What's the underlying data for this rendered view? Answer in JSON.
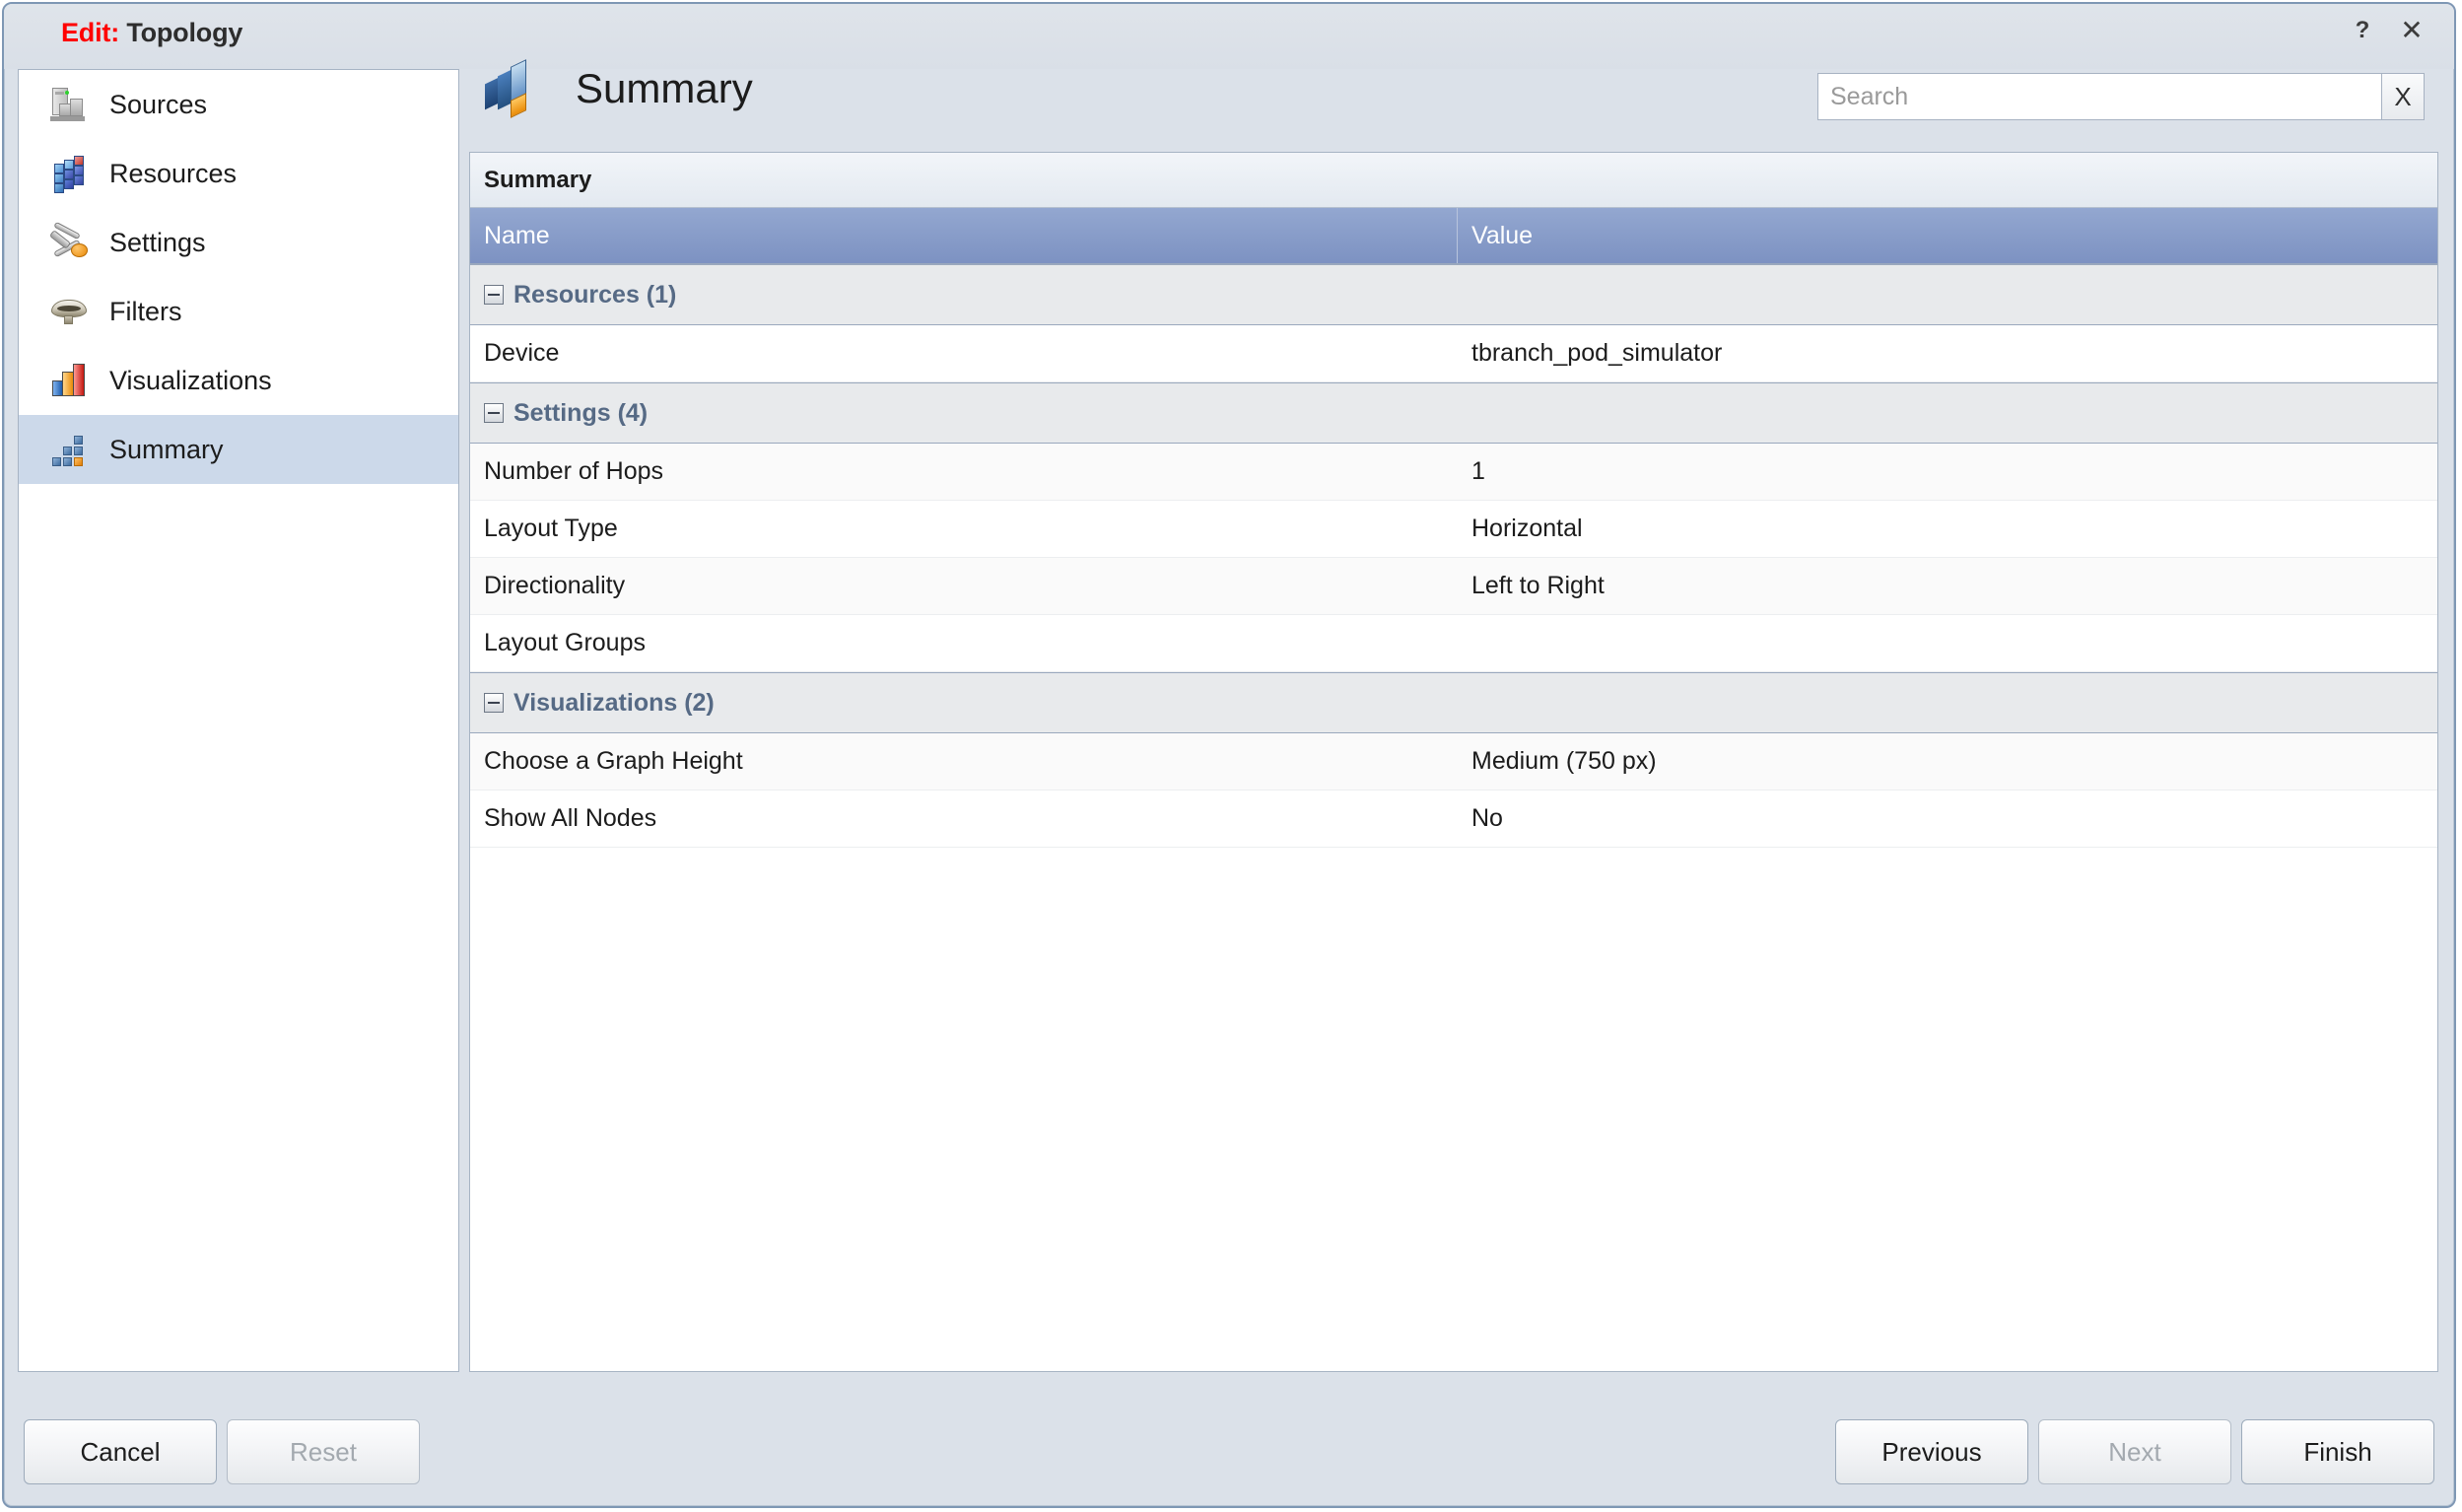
{
  "window": {
    "title_prefix": "Edit:",
    "title_main": "Topology",
    "help_glyph": "?",
    "close_glyph": "✕"
  },
  "sidebar": {
    "items": [
      {
        "label": "Sources",
        "icon": "server-rack-icon",
        "selected": false
      },
      {
        "label": "Resources",
        "icon": "cube-icon",
        "selected": false
      },
      {
        "label": "Settings",
        "icon": "tools-icon",
        "selected": false
      },
      {
        "label": "Filters",
        "icon": "funnel-icon",
        "selected": false
      },
      {
        "label": "Visualizations",
        "icon": "bar-chart-icon",
        "selected": false
      },
      {
        "label": "Summary",
        "icon": "blocks-icon",
        "selected": true
      }
    ]
  },
  "header": {
    "icon": "summary-blocks-icon",
    "title": "Summary"
  },
  "search": {
    "value": "",
    "placeholder": "Search",
    "clear_label": "X"
  },
  "panel": {
    "title": "Summary",
    "columns": {
      "name": "Name",
      "value": "Value"
    },
    "groups": [
      {
        "label": "Resources (1)",
        "expanded": true,
        "rows": [
          {
            "name": "Device",
            "value": "tbranch_pod_simulator"
          }
        ]
      },
      {
        "label": "Settings (4)",
        "expanded": true,
        "rows": [
          {
            "name": "Number of Hops",
            "value": "1"
          },
          {
            "name": "Layout Type",
            "value": "Horizontal"
          },
          {
            "name": "Directionality",
            "value": "Left to Right"
          },
          {
            "name": "Layout Groups",
            "value": ""
          }
        ]
      },
      {
        "label": "Visualizations (2)",
        "expanded": true,
        "rows": [
          {
            "name": "Choose a Graph Height",
            "value": "Medium (750 px)"
          },
          {
            "name": "Show All Nodes",
            "value": "No"
          }
        ]
      }
    ]
  },
  "footer": {
    "cancel": {
      "label": "Cancel",
      "enabled": true
    },
    "reset": {
      "label": "Reset",
      "enabled": false
    },
    "previous": {
      "label": "Previous",
      "enabled": true
    },
    "next": {
      "label": "Next",
      "enabled": false
    },
    "finish": {
      "label": "Finish",
      "enabled": true
    }
  },
  "colors": {
    "title_accent": "#ff0000",
    "dialog_bg": "#dbe1e9",
    "header_row": "#7d92c2",
    "group_label": "#566a85",
    "selected_nav": "#ccd9ea"
  }
}
